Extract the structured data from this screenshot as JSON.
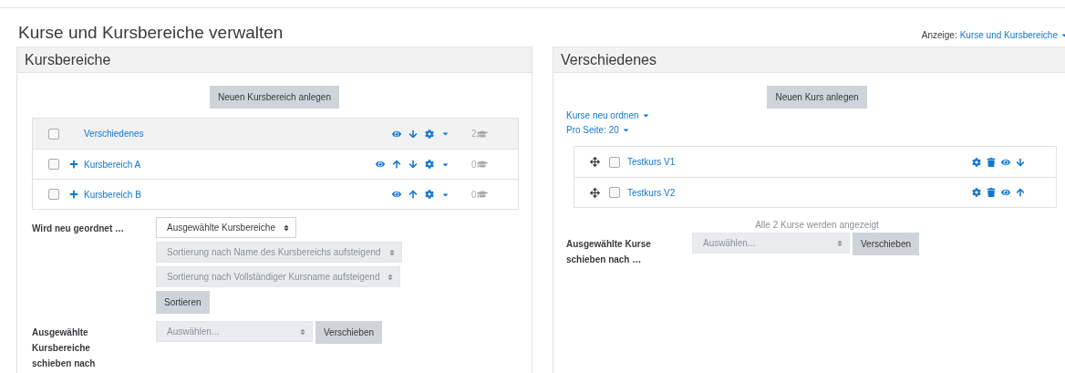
{
  "page_title": "Kurse und Kursbereiche verwalten",
  "view_switch": {
    "label": "Anzeige:",
    "value": "Kurse und Kursbereiche"
  },
  "categories_panel": {
    "title": "Kursbereiche",
    "create_button": "Neuen Kursbereich anlegen",
    "categories": [
      {
        "name": "Verschiedenes",
        "selected": true,
        "checked": false,
        "expandable": false,
        "actions": [
          {
            "kind": "eye"
          },
          {
            "kind": "down"
          },
          {
            "kind": "gear"
          }
        ],
        "count": "2"
      },
      {
        "name": "Kursbereich A",
        "selected": false,
        "checked": false,
        "expandable": true,
        "actions": [
          {
            "kind": "eye"
          },
          {
            "kind": "up"
          },
          {
            "kind": "down"
          },
          {
            "kind": "gear"
          }
        ],
        "count": "0"
      },
      {
        "name": "Kursbereich B",
        "selected": false,
        "checked": false,
        "expandable": true,
        "actions": [
          {
            "kind": "eye"
          },
          {
            "kind": "up"
          },
          {
            "kind": "gear"
          }
        ],
        "count": "0"
      }
    ],
    "resort": {
      "label": "Wird neu geordnet …",
      "selects": [
        {
          "value": "Ausgewählte Kursbereiche",
          "disabled": false
        },
        {
          "value": "Sortierung nach Name des Kursbereichs aufsteigend",
          "disabled": true
        },
        {
          "value": "Sortierung nach Vollständiger Kursname aufsteigend",
          "disabled": true
        }
      ],
      "button": "Sortieren"
    },
    "move": {
      "label": "Ausgewählte Kursbereiche schieben nach",
      "placeholder": "Auswählen...",
      "button": "Verschieben"
    }
  },
  "courses_panel": {
    "title": "Verschiedenes",
    "create_button": "Neuen Kurs anlegen",
    "sort_menu": "Kurse neu ordnen",
    "per_page": "Pro Seite: 20",
    "courses": [
      {
        "name": "Testkurs V1",
        "checked": false,
        "actions": [
          {
            "kind": "gear"
          },
          {
            "kind": "trash"
          },
          {
            "kind": "eye"
          },
          {
            "kind": "down"
          }
        ]
      },
      {
        "name": "Testkurs V2",
        "checked": false,
        "actions": [
          {
            "kind": "gear"
          },
          {
            "kind": "trash"
          },
          {
            "kind": "eye"
          },
          {
            "kind": "up"
          }
        ]
      }
    ],
    "listing_info": "Alle 2 Kurse werden angezeigt",
    "move": {
      "label": "Ausgewählte Kurse schieben nach …",
      "placeholder": "Auswählen...",
      "button": "Verschieben"
    }
  }
}
